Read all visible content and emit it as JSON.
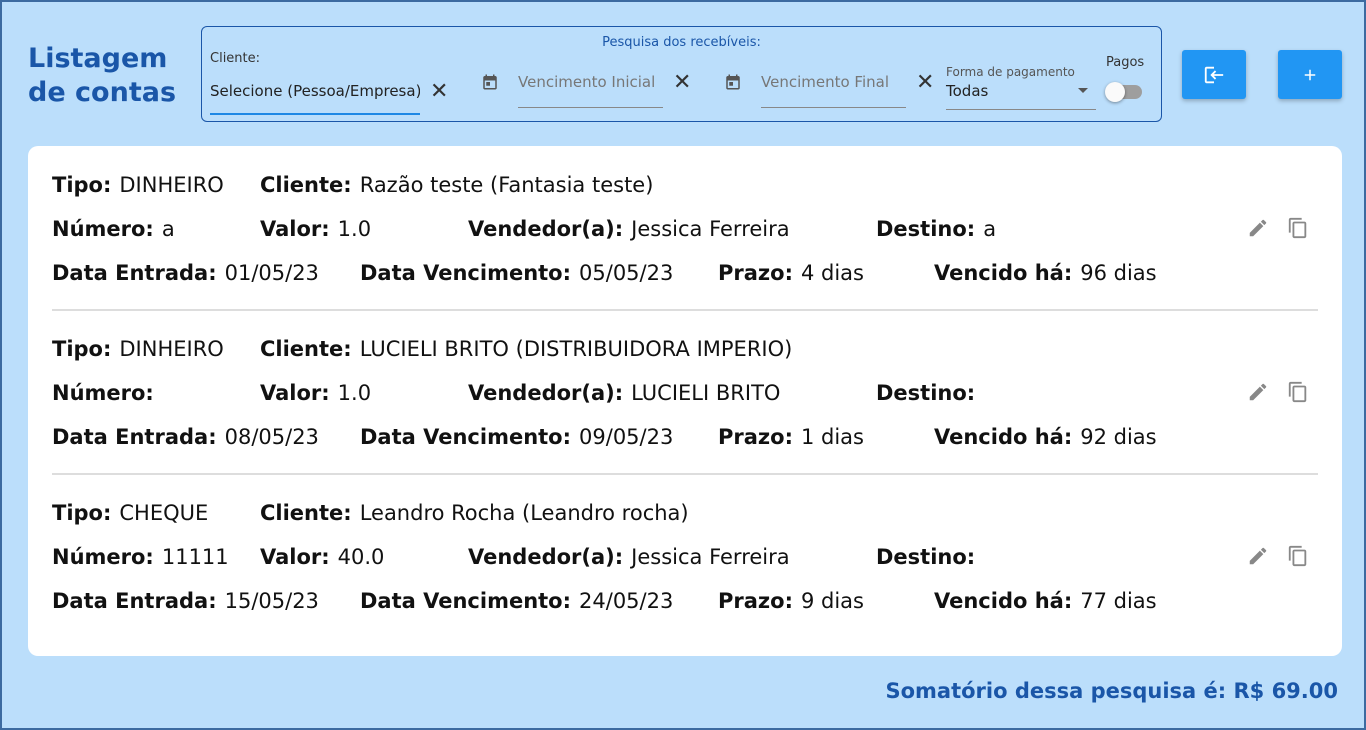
{
  "page_title": "Listagem de contas",
  "filters": {
    "title": "Pesquisa dos recebíveis:",
    "client_label": "Cliente:",
    "client_value": "Selecione (Pessoa/Empresa)",
    "start_placeholder": "Vencimento Inicial",
    "end_placeholder": "Vencimento Final",
    "payment_label": "Forma de pagamento",
    "payment_value": "Todas",
    "paid_label": "Pagos",
    "paid_on": false
  },
  "labels": {
    "tipo": "Tipo:",
    "cliente": "Cliente:",
    "numero": "Número:",
    "valor": "Valor:",
    "vendedor": "Vendedor(a):",
    "destino": "Destino:",
    "data_entrada": "Data Entrada:",
    "data_vencimento": "Data Vencimento:",
    "prazo": "Prazo:",
    "vencido": "Vencido há:"
  },
  "records": [
    {
      "tipo": "DINHEIRO",
      "cliente": "Razão teste (Fantasia teste)",
      "numero": "a",
      "valor": "1.0",
      "vendedor": "Jessica Ferreira",
      "destino": "a",
      "data_entrada": "01/05/23",
      "data_vencimento": "05/05/23",
      "prazo": "4 dias",
      "vencido": "96 dias"
    },
    {
      "tipo": "DINHEIRO",
      "cliente": "LUCIELI BRITO (DISTRIBUIDORA IMPERIO)",
      "numero": "",
      "valor": "1.0",
      "vendedor": "LUCIELI BRITO",
      "destino": "",
      "data_entrada": "08/05/23",
      "data_vencimento": "09/05/23",
      "prazo": "1 dias",
      "vencido": "92 dias"
    },
    {
      "tipo": "CHEQUE",
      "cliente": "Leandro Rocha (Leandro rocha)",
      "numero": "11111",
      "valor": "40.0",
      "vendedor": "Jessica Ferreira",
      "destino": "",
      "data_entrada": "15/05/23",
      "data_vencimento": "24/05/23",
      "prazo": "9 dias",
      "vencido": "77 dias"
    }
  ],
  "total_text": "Somatório dessa pesquisa é: R$ 69.00",
  "colors": {
    "accent": "#2196f3",
    "title": "#1a56a8",
    "background": "#bbdefb"
  },
  "icons": [
    "calendar-icon",
    "close-icon",
    "login-icon",
    "plus-icon",
    "edit-icon",
    "copy-icon"
  ]
}
